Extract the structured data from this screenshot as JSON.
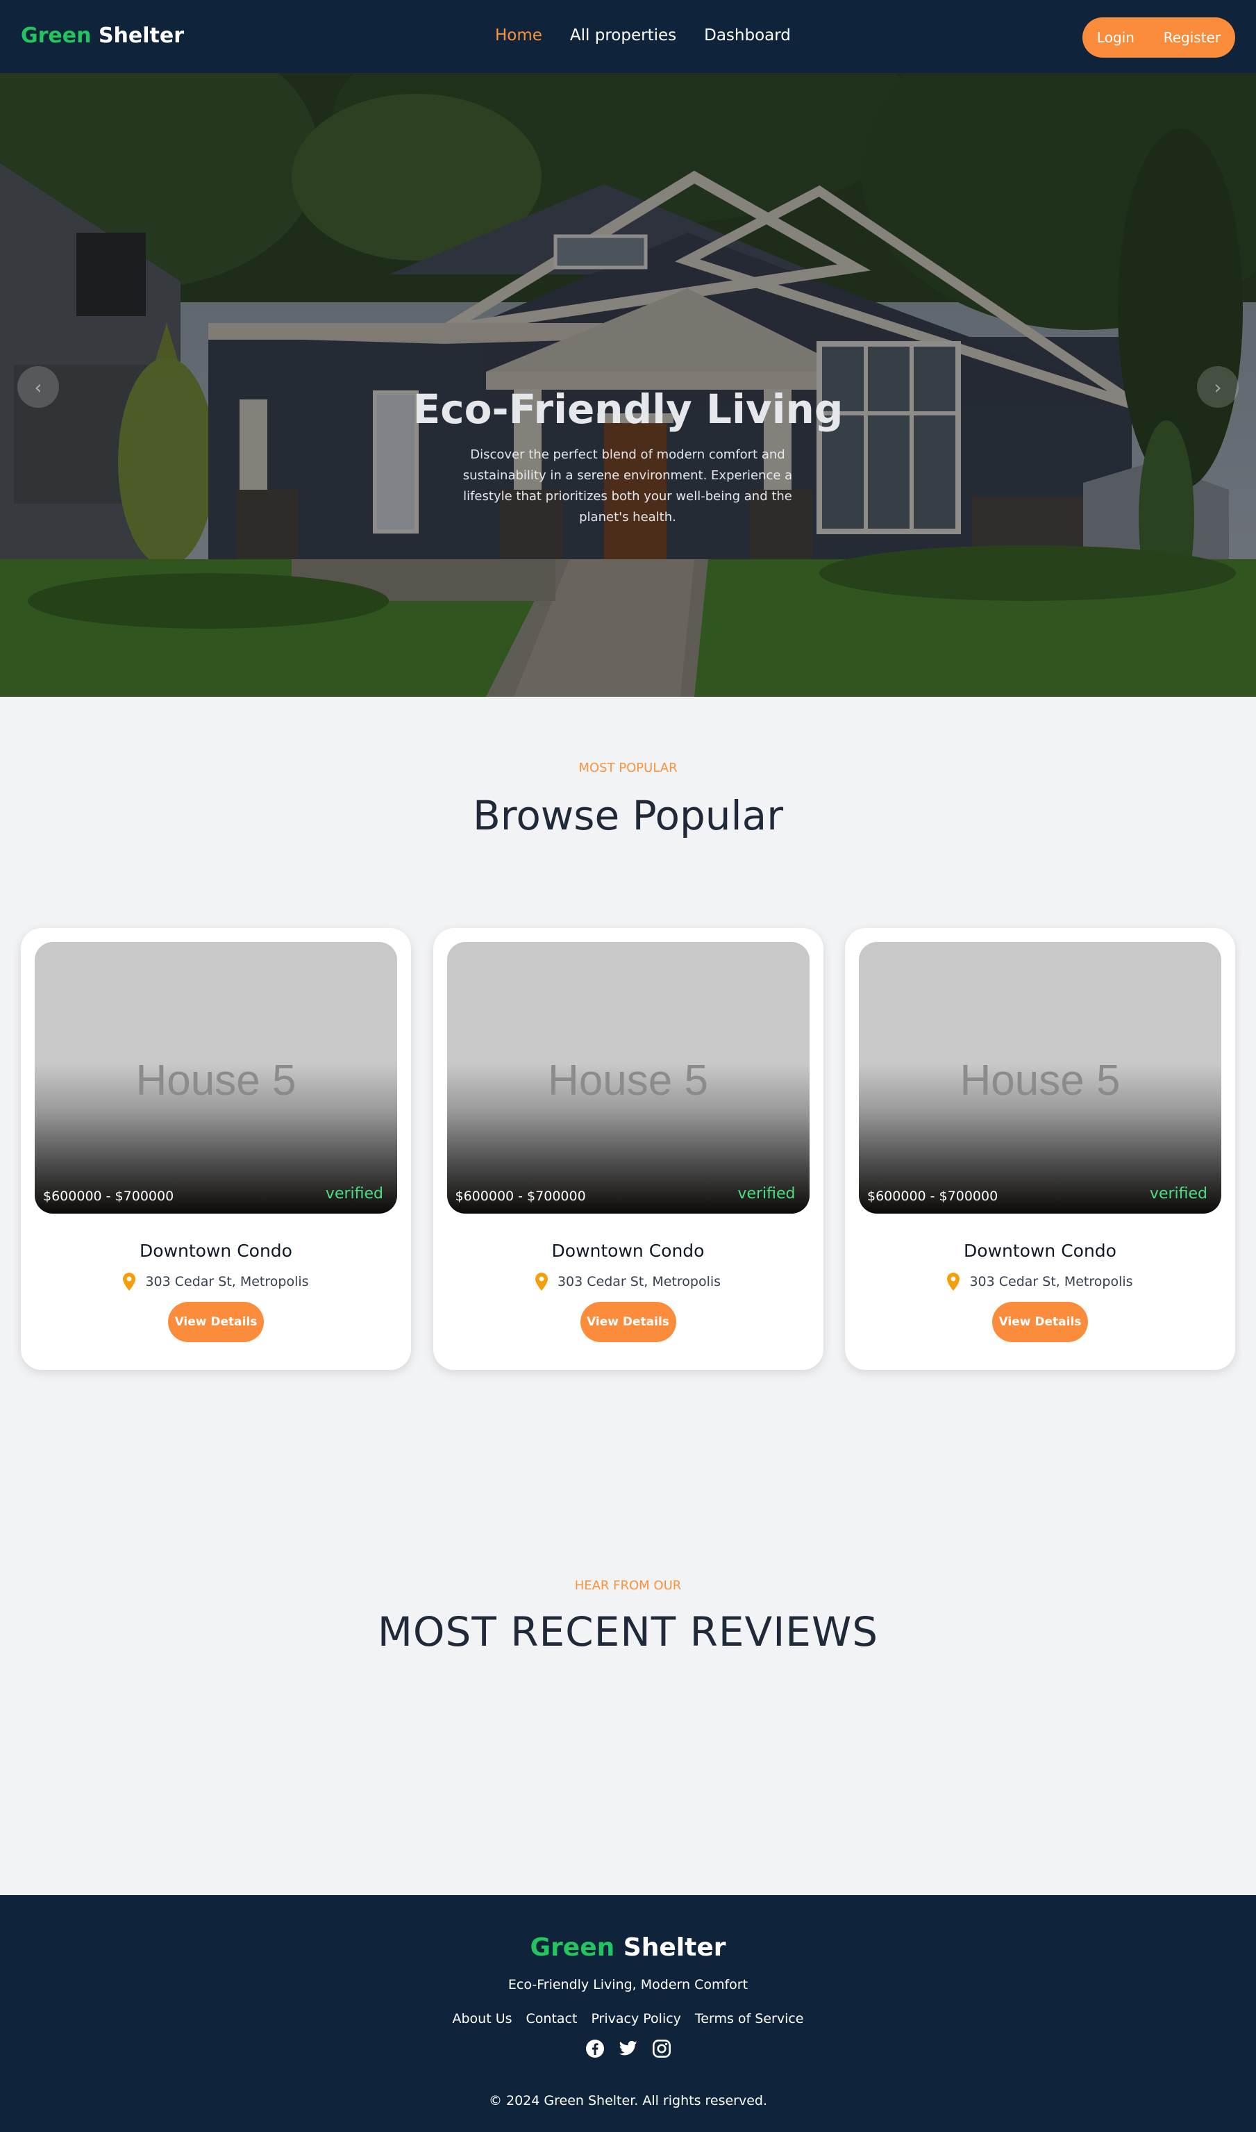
{
  "nav": {
    "brand_green": "Green",
    "brand_white": "Shelter",
    "links": [
      "Home",
      "All properties",
      "Dashboard"
    ],
    "active_link": "Home",
    "login_label": "Login",
    "register_label": "Register"
  },
  "hero": {
    "title": "Eco-Friendly Living",
    "text": "Discover the perfect blend of modern comfort and sustainability in a serene environment. Experience a lifestyle that prioritizes both your well-being and the planet's health.",
    "prev_arrow": "‹",
    "next_arrow": "›"
  },
  "popular": {
    "kicker": "MOST POPULAR",
    "title": "Browse Popular",
    "cards": [
      {
        "image_label": "House 5",
        "price": "$600000 - $700000",
        "status": "verified",
        "name": "Downtown Condo",
        "location": "303 Cedar St, Metropolis",
        "button": "View Details"
      },
      {
        "image_label": "House 5",
        "price": "$600000 - $700000",
        "status": "verified",
        "name": "Downtown Condo",
        "location": "303 Cedar St, Metropolis",
        "button": "View Details"
      },
      {
        "image_label": "House 5",
        "price": "$600000 - $700000",
        "status": "verified",
        "name": "Downtown Condo",
        "location": "303 Cedar St, Metropolis",
        "button": "View Details"
      }
    ]
  },
  "reviews": {
    "kicker": "HEAR FROM OUR",
    "title": "MOST RECENT REVIEWS"
  },
  "footer": {
    "brand_green": "Green",
    "brand_white": "Shelter",
    "tagline": "Eco-Friendly Living, Modern Comfort",
    "links": [
      "About Us",
      "Contact",
      "Privacy Policy",
      "Terms of Service"
    ],
    "social_icons": [
      "facebook-icon",
      "twitter-icon",
      "instagram-icon"
    ],
    "copyright": "© 2024 Green Shelter. All rights reserved."
  },
  "colors": {
    "navy": "#0f233a",
    "accent_orange": "#fb8c3c",
    "brand_green": "#22c55e",
    "verified_green": "#4ade80",
    "page_bg": "#f2f3f5"
  }
}
